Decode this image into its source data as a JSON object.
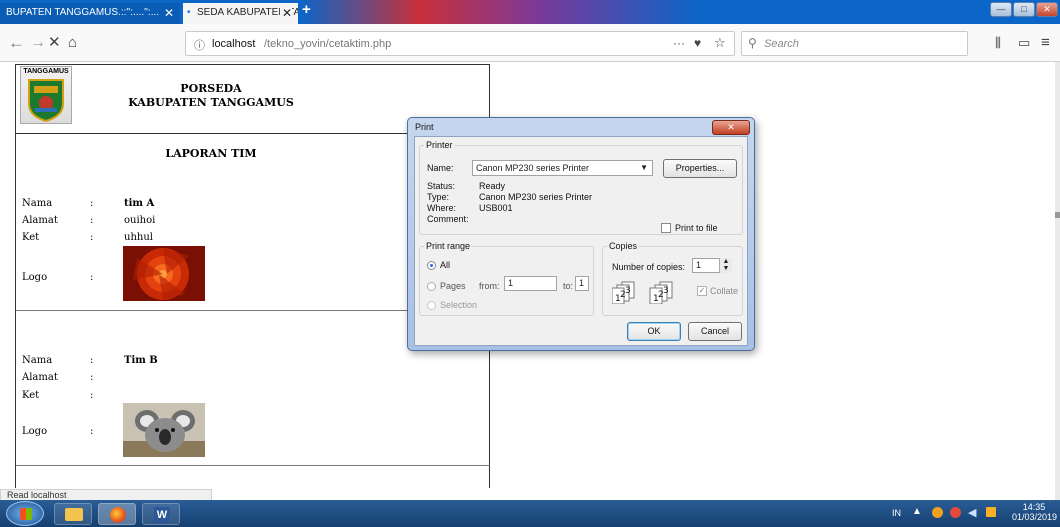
{
  "browser": {
    "tabs": [
      {
        "label": "BUPATEN TANGGAMUS.::'':....'':...",
        "active": false
      },
      {
        "label": "SEDA KABUPATEN TANGGAMU",
        "active": true
      }
    ],
    "url_host": "localhost",
    "url_path": "/tekno_yovin/cetaktim.php",
    "search_placeholder": "Search",
    "status_text": "Read localhost"
  },
  "report": {
    "logo_text": "TANGGAMUS",
    "title_line1": "PORSEDA",
    "title_line2": "KABUPATEN TANGGAMUS",
    "section_title": "LAPORAN TIM",
    "labels": {
      "name": "Nama",
      "address": "Alamat",
      "notes": "Ket",
      "logo": "Logo",
      "sep": ":"
    },
    "teams": [
      {
        "name": "tim A",
        "address": "ouihoi",
        "notes": "uhhul",
        "image": "flower"
      },
      {
        "name": "Tim B",
        "address": "",
        "notes": "",
        "image": "koala"
      }
    ]
  },
  "print_dialog": {
    "title": "Print",
    "printer_group": "Printer",
    "name_label": "Name:",
    "printer_name": "Canon MP230 series Printer",
    "properties_button": "Properties...",
    "status_label": "Status:",
    "status_value": "Ready",
    "type_label": "Type:",
    "type_value": "Canon MP230 series Printer",
    "where_label": "Where:",
    "where_value": "USB001",
    "comment_label": "Comment:",
    "print_to_file": "Print to file",
    "range_group": "Print range",
    "range_all": "All",
    "range_pages": "Pages",
    "from_label": "from:",
    "from_value": "1",
    "to_label": "to:",
    "to_value": "1",
    "range_selection": "Selection",
    "copies_group": "Copies",
    "copies_label": "Number of copies:",
    "copies_value": "1",
    "collate": "Collate",
    "ok_button": "OK",
    "cancel_button": "Cancel"
  },
  "taskbar": {
    "lang": "IN",
    "time": "14:35",
    "date": "01/03/2019"
  }
}
